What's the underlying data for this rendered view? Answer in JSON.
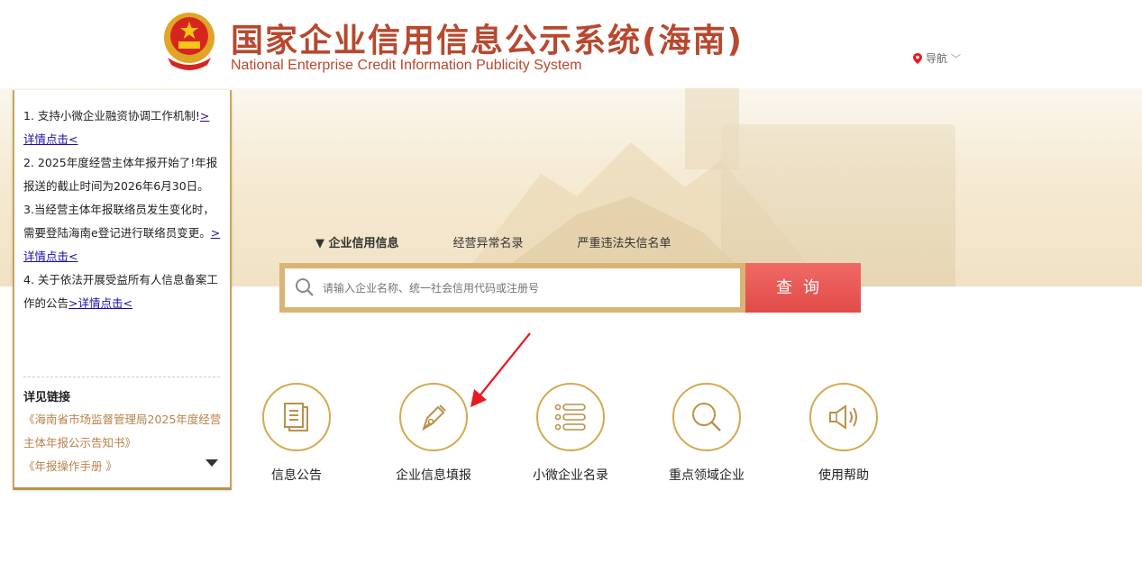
{
  "header": {
    "title_zh": "国家企业信用信息公示系统(海南)",
    "title_en": "National Enterprise Credit Information Publicity System",
    "nav_label": "导航"
  },
  "notice": {
    "items": [
      {
        "text": "1. 支持小微企业融资协调工作机制!",
        "link": "> 详情点击<"
      },
      {
        "text": "2. 2025年度经营主体年报开始了!年报报送的截止时间为2026年6月30日。"
      },
      {
        "text": "3.当经营主体年报联络员发生变化时，需要登陆海南e登记进行联络员变更。",
        "link": "> 详情点击<"
      },
      {
        "text": "4. 关于依法开展受益所有人信息备案工作的公告",
        "link": ">详情点击<"
      }
    ],
    "links_title": "详见链接",
    "links": [
      "《海南省市场监督管理局2025年度经营主体年报公示告知书》",
      "《年报操作手册 》"
    ]
  },
  "search": {
    "tabs": [
      "▼ 企业信用信息",
      "经营异常名录",
      "严重违法失信名单"
    ],
    "placeholder": "请输入企业名称、统一社会信用代码或注册号",
    "button": "查询"
  },
  "features": [
    {
      "label": "信息公告",
      "icon": "document-icon"
    },
    {
      "label": "企业信息填报",
      "icon": "pen-icon"
    },
    {
      "label": "小微企业名录",
      "icon": "list-icon"
    },
    {
      "label": "重点领域企业",
      "icon": "search-icon"
    },
    {
      "label": "使用帮助",
      "icon": "speaker-icon"
    }
  ],
  "colors": {
    "brand": "#b8482e",
    "gold": "#d4a94f",
    "search_button": "#e14b48",
    "annotation_arrow": "#e8191c"
  }
}
